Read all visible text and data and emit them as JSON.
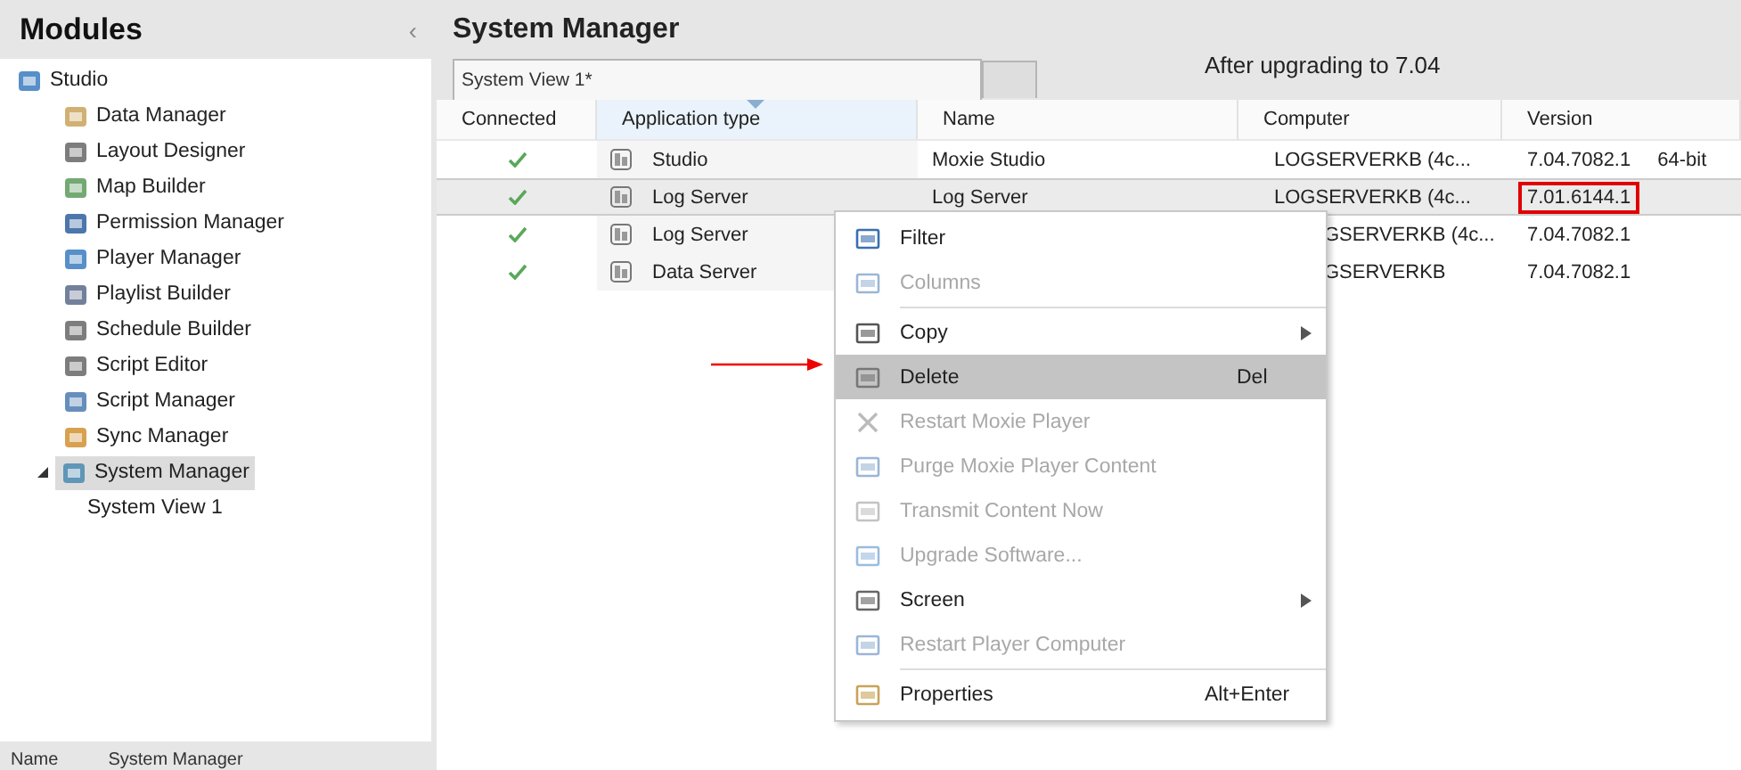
{
  "sidebar": {
    "title": "Modules",
    "collapse_glyph": "‹",
    "tree": [
      {
        "label": "Studio",
        "selected": false,
        "children": [
          {
            "label": "Data Manager",
            "selected": false
          },
          {
            "label": "Layout Designer",
            "selected": false
          },
          {
            "label": "Map Builder",
            "selected": false
          },
          {
            "label": "Permission Manager",
            "selected": false
          },
          {
            "label": "Player Manager",
            "selected": false
          },
          {
            "label": "Playlist Builder",
            "selected": false
          },
          {
            "label": "Schedule Builder",
            "selected": false
          },
          {
            "label": "Script Editor",
            "selected": false
          },
          {
            "label": "Script Manager",
            "selected": false
          },
          {
            "label": "Sync Manager",
            "selected": false
          },
          {
            "label": "System Manager",
            "selected": true,
            "expanded": true,
            "children": [
              {
                "label": "System View 1",
                "selected": false
              }
            ]
          }
        ]
      }
    ],
    "footer": {
      "label": "Name",
      "value": "System Manager"
    }
  },
  "main": {
    "title": "System Manager",
    "tabs": [
      {
        "label": "System View 1*",
        "selected": true
      },
      {
        "selected": false
      }
    ],
    "note": "After upgrading to 7.04",
    "table": {
      "columns": [
        {
          "label": "Connected",
          "sorted": false
        },
        {
          "label": "Application type",
          "sorted": true
        },
        {
          "label": "Name",
          "sorted": false
        },
        {
          "label": "Computer",
          "sorted": false
        },
        {
          "label": "Version",
          "sorted": false
        }
      ],
      "rows": [
        {
          "connected": true,
          "app_type": "Studio",
          "name": "Moxie Studio",
          "computer": "LOGSERVERKB (4c...",
          "version": "7.04.7082.1",
          "arch": "64-bit",
          "selected": false,
          "highlighted": false
        },
        {
          "connected": true,
          "app_type": "Log Server",
          "name": "Log Server",
          "computer": "LOGSERVERKB (4c...",
          "version": "7.01.6144.1",
          "selected": true,
          "highlighted": true
        },
        {
          "connected": true,
          "app_type": "Log Server",
          "name": "",
          "computer": "GSERVERKB (4c...",
          "version": "7.04.7082.1",
          "selected": false,
          "highlighted": false
        },
        {
          "connected": true,
          "app_type": "Data Server",
          "name": "",
          "computer": "GSERVERKB",
          "version": "7.04.7082.1",
          "selected": false,
          "highlighted": false
        }
      ]
    }
  },
  "context_menu": {
    "items": [
      {
        "kind": "item",
        "label": "Filter",
        "disabled": false,
        "selected": false
      },
      {
        "kind": "item",
        "label": "Columns",
        "disabled": true,
        "selected": false
      },
      {
        "kind": "separator"
      },
      {
        "kind": "item",
        "label": "Copy",
        "disabled": false,
        "selected": false,
        "submenu": true
      },
      {
        "kind": "item",
        "label": "Delete",
        "shortcut": "Del",
        "disabled": false,
        "selected": true
      },
      {
        "kind": "item",
        "label": "Restart Moxie Player",
        "disabled": true,
        "selected": false
      },
      {
        "kind": "item",
        "label": "Purge Moxie Player Content",
        "disabled": true,
        "selected": false
      },
      {
        "kind": "item",
        "label": "Transmit Content Now",
        "disabled": true,
        "selected": false
      },
      {
        "kind": "item",
        "label": "Upgrade Software...",
        "disabled": true,
        "selected": false
      },
      {
        "kind": "item",
        "label": "Screen",
        "disabled": false,
        "selected": false,
        "submenu": true
      },
      {
        "kind": "item",
        "label": "Restart Player Computer",
        "disabled": true,
        "selected": false
      },
      {
        "kind": "separator"
      },
      {
        "kind": "item",
        "label": "Properties",
        "shortcut": "Alt+Enter",
        "disabled": false,
        "selected": false
      }
    ]
  }
}
